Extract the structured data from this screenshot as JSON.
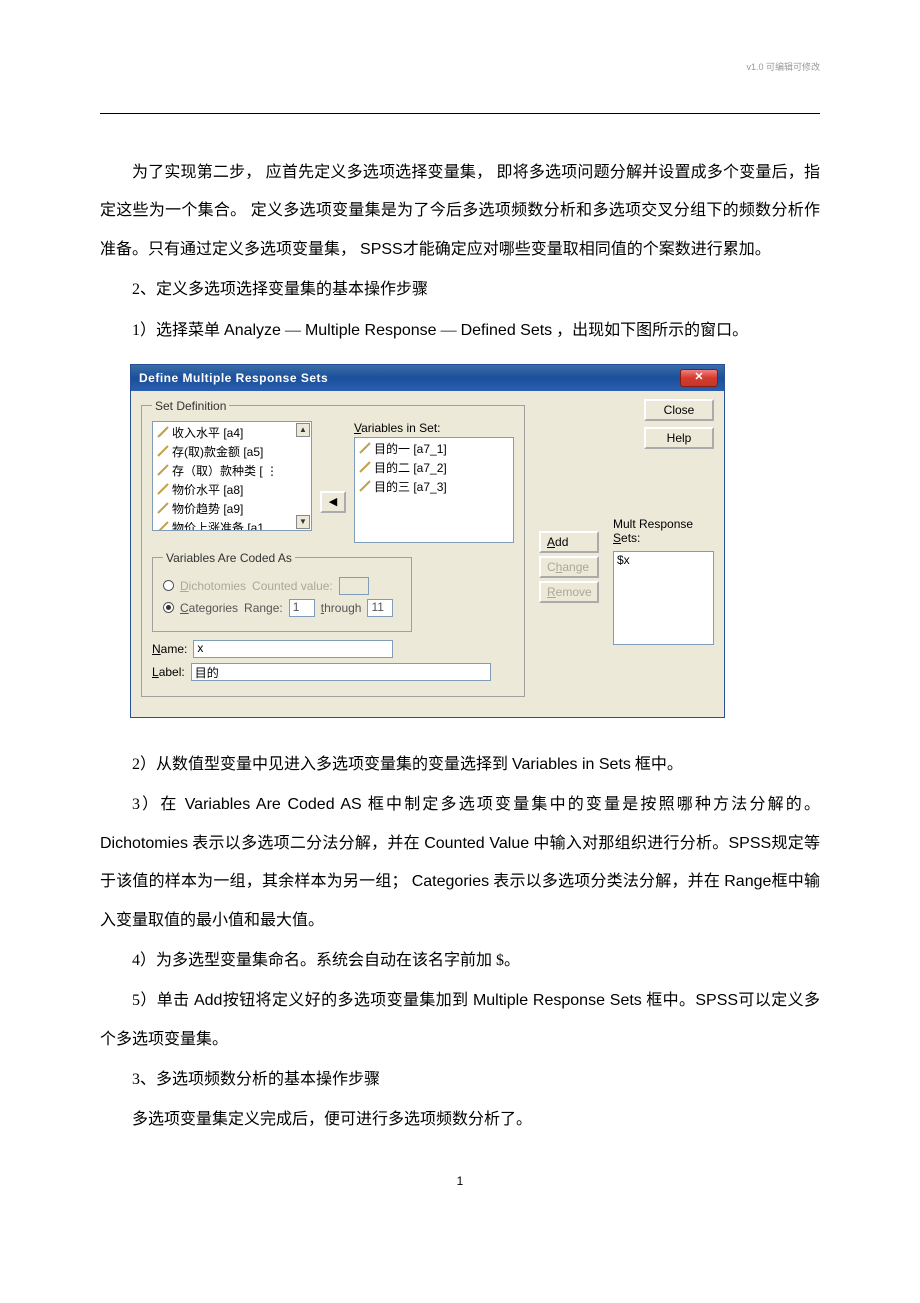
{
  "meta": {
    "header_note": "v1.0  可编辑可修改",
    "page_number": "1"
  },
  "paragraphs": {
    "p1": "为了实现第二步， 应首先定义多选项选择变量集， 即将多选项问题分解并设置成多个变量后，指定这些为一个集合。 定义多选项变量集是为了今后多选项频数分析和多选项交叉分组下的频数分析作准备。只有通过定义多选项变量集，",
    "p1_tail": "才能确定应对哪些变量取相同值的个案数进行累加。",
    "p1_spss": "SPSS",
    "p2": "2、定义多选项选择变量集的基本操作步骤",
    "p3_a": "1）选择菜单 ",
    "p3_b": "Analyze",
    "p3_dash1": " — ",
    "p3_c": "Multiple Response",
    "p3_dash2": "    — ",
    "p3_d": "Defined Sets",
    "p3_e": " ，出现如下图所示的窗口。",
    "p4_a": "2）从数值型变量中见进入多选项变量集的变量选择到    ",
    "p4_b": "Variables in Sets",
    "p4_c": "    框中。",
    "p5_a": "3）在 ",
    "p5_b": "Variables Are Coded AS",
    "p5_c": "  框中制定多选项变量集中的变量是按照哪种方法分解的。",
    "p5_d": "Dichotomies",
    "p5_e": " 表示以多选项二分法分解，并在   ",
    "p5_f": "Counted Value",
    "p5_g": " 中输入对那组织进行分析。",
    "p5_h": "SPSS",
    "p5_i": "规定等于该值的样本为一组，其余样本为另一组；    ",
    "p5_j": "Categories",
    "p5_k": " 表示以多选项分类法分解，并在 ",
    "p5_l": "Range",
    "p5_m": "框中输入变量取值的最小值和最大值。",
    "p6": "4）为多选型变量集命名。系统会自动在该名字前加    $。",
    "p7_a": "5）单击 ",
    "p7_b": "Add",
    "p7_c": "按钮将定义好的多选项变量集加到   ",
    "p7_d": "Multiple   Response Sets",
    "p7_e": " 框中。",
    "p7_f": "SPSS",
    "p7_g": "可以定义多个多选项变量集。",
    "p8": "3、多选项频数分析的基本操作步骤",
    "p9": "多选项变量集定义完成后，便可进行多选项频数分析了。"
  },
  "dialog": {
    "title": "Define Multiple Response Sets",
    "close_x": "✕",
    "groupbox_setdef": "Set Definition",
    "source_vars": [
      "收入水平 [a4]",
      "存(取)款金额 [a5]",
      "存（取）款种类 [ ⋮",
      "物价水平 [a8]",
      "物价趋势 [a9]",
      "物价上涨准备 [a1"
    ],
    "vars_in_set_label": "Variables in Set:",
    "vars_in_set": [
      "目的一 [a7_1]",
      "目的二 [a7_2]",
      "目的三 [a7_3]"
    ],
    "groupbox_coded": "Variables Are Coded As",
    "dichotomies_label": "Dichotomies",
    "counted_value_label": "Counted value:",
    "categories_label": "Categories",
    "range_label": "Range:",
    "range_from": "1",
    "through_label": "through",
    "range_to": "11",
    "name_label": "Name:",
    "name_value": "x",
    "label_label": "Label:",
    "label_value": "目的",
    "btn_close": "Close",
    "btn_help": "Help",
    "btn_add": "Add",
    "btn_change": "Change",
    "btn_remove": "Remove",
    "mrsets_label": "Mult Response Sets:",
    "mrsets_value": "$x"
  }
}
